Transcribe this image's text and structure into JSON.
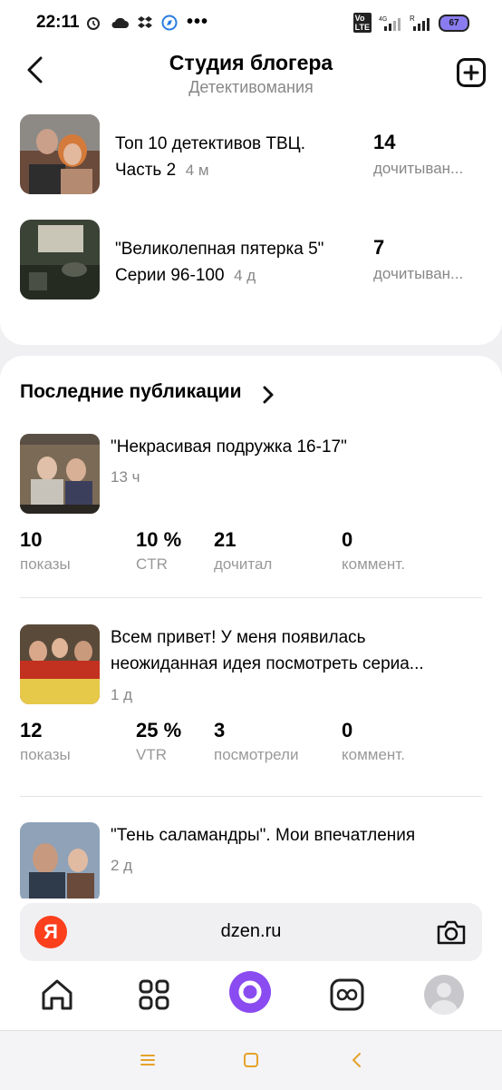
{
  "status": {
    "time": "22:11",
    "battery": "67"
  },
  "header": {
    "title": "Студия блогера",
    "subtitle": "Детективомания"
  },
  "top_items": [
    {
      "title": "Топ 10 детективов ТВЦ. Часть 2",
      "title_line1": "Топ 10 детективов ТВЦ.",
      "title_line2": "Часть 2",
      "age": "4 м",
      "count": "14",
      "count_label": "дочитыван..."
    },
    {
      "title": "\"Великолепная пятерка 5\" Серии 96-100",
      "title_line1": "\"Великолепная пятерка 5\"",
      "title_line2": "Серии 96-100",
      "age": "4 д",
      "count": "7",
      "count_label": "дочитыван..."
    }
  ],
  "recent": {
    "heading": "Последние публикации",
    "items": [
      {
        "title": "\"Некрасивая подружка 16-17\"",
        "age": "13 ч",
        "stats": [
          {
            "value": "10",
            "label": "показы"
          },
          {
            "value": "10 %",
            "label": "CTR"
          },
          {
            "value": "21",
            "label": "дочитал"
          },
          {
            "value": "0",
            "label": "коммент."
          }
        ]
      },
      {
        "title_line1": "Всем привет! У меня появилась",
        "title_line2": "неожиданная идея посмотреть сериа...",
        "age": "1 д",
        "stats": [
          {
            "value": "12",
            "label": "показы"
          },
          {
            "value": "25 %",
            "label": "VTR"
          },
          {
            "value": "3",
            "label": "посмотрели"
          },
          {
            "value": "0",
            "label": "коммент."
          }
        ]
      },
      {
        "title": "\"Тень саламандры\". Мои впечатления",
        "age": "2 д"
      }
    ]
  },
  "browser": {
    "logo": "Я",
    "url": "dzen.ru"
  },
  "icons": {
    "back": "back-arrow-icon",
    "add": "plus-square-icon",
    "home": "home-icon",
    "grid": "apps-grid-icon",
    "alice": "alice-icon",
    "infinity": "infinity-icon",
    "profile": "avatar-icon",
    "camera": "camera-icon"
  }
}
